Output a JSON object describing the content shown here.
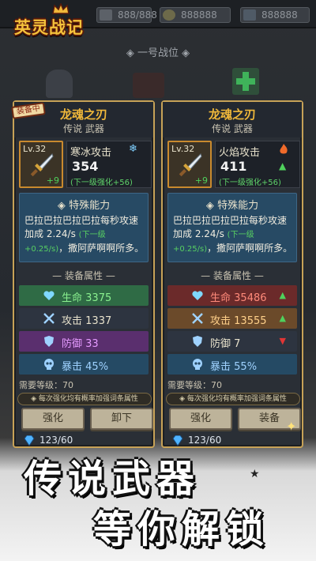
{
  "logo": {
    "title": "英灵战记"
  },
  "resources": [
    {
      "name": "stamina",
      "value": "888/888"
    },
    {
      "name": "gold",
      "value": "888888"
    },
    {
      "name": "gems",
      "value": "888888"
    }
  ],
  "slot_label": "一号战位",
  "equipped_tag": "装备中",
  "cards": [
    {
      "name": "龙魂之刃",
      "subtitle": "传说 武器",
      "level": "Lv.32",
      "plus": "+9",
      "attack_name": "寒冰攻击",
      "attack_value": "354",
      "attack_next": "(下一级强化+56)",
      "special_title": "特殊能力",
      "special_text": "巴拉巴拉巴拉巴拉每秒攻速加成 2.24/s",
      "special_next": "(下一级+0.25/s)",
      "special_tail": "，撒阿萨啊啊所多。",
      "equip_header": "装备属性",
      "stats": [
        {
          "label": "生命",
          "value": "3375"
        },
        {
          "label": "攻击",
          "value": "1337"
        },
        {
          "label": "防御",
          "value": "33"
        },
        {
          "label": "暴击",
          "value": "45%"
        }
      ],
      "requirement": "需要等级：70",
      "note": "每次强化均有概率加强词条属性",
      "btn_left": "强化",
      "btn_right": "卸下",
      "gems": "123/60"
    },
    {
      "name": "龙魂之刃",
      "subtitle": "传说 武器",
      "level": "Lv.32",
      "plus": "+9",
      "attack_name": "火焰攻击",
      "attack_value": "411",
      "attack_next": "(下一级强化+56)",
      "special_title": "特殊能力",
      "special_text": "巴拉巴拉巴拉巴拉每秒攻速加成 2.24/s",
      "special_next": "(下一级+0.25/s)",
      "special_tail": "，撒阿萨啊啊所多。",
      "equip_header": "装备属性",
      "stats": [
        {
          "label": "生命",
          "value": "35486"
        },
        {
          "label": "攻击",
          "value": "13555"
        },
        {
          "label": "防御",
          "value": "7"
        },
        {
          "label": "暴击",
          "value": "55%"
        }
      ],
      "requirement": "需要等级：70",
      "note": "每次强化均有概率加强词条属性",
      "btn_left": "强化",
      "btn_right": "装备",
      "gems": "123/60"
    }
  ],
  "banner": {
    "line1": "传说武器",
    "line2": "等你解锁"
  },
  "colors": {
    "gold": "#f0b83a",
    "up": "#4fd15c",
    "down": "#e03535",
    "hp": "#2f6b45",
    "atk": "#2d3440",
    "def": "#5a2f6e",
    "crit": "#254a64"
  }
}
